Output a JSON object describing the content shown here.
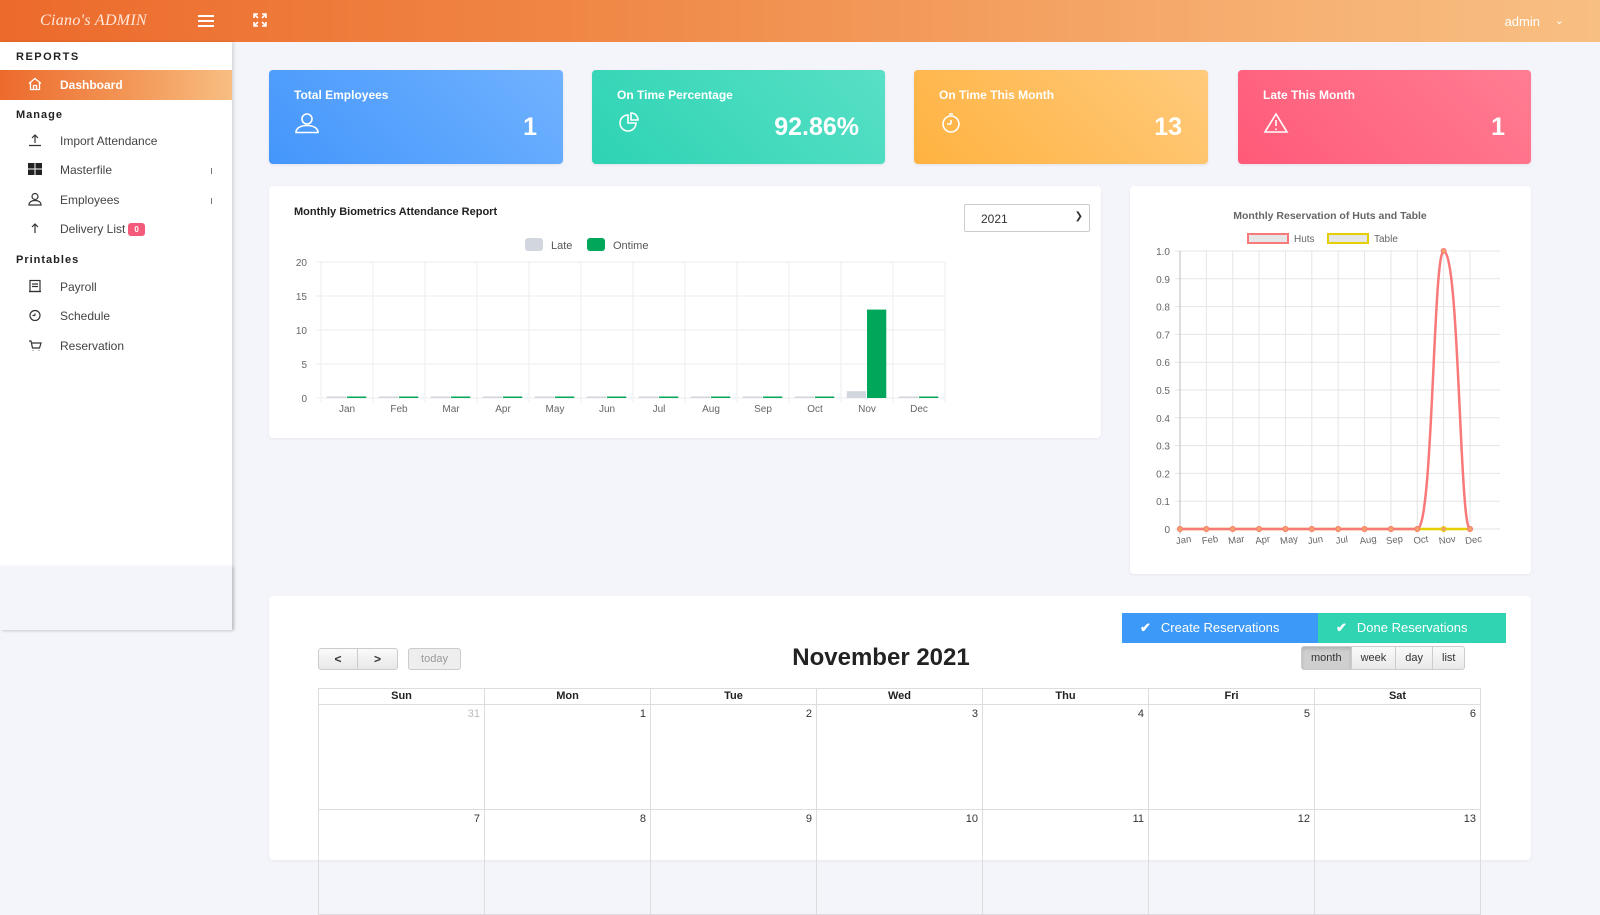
{
  "header": {
    "brand": "Ciano's ADMIN",
    "user": "admin"
  },
  "sidebar": {
    "sections": [
      "REPORTS",
      "Manage",
      "Printables"
    ],
    "active": {
      "label": "Dashboard",
      "icon": "home-icon"
    },
    "manage_items": [
      {
        "label": "Import Attendance",
        "icon": "upload-icon"
      },
      {
        "label": "Masterfile",
        "icon": "grid-icon",
        "expandable": true
      },
      {
        "label": "Employees",
        "icon": "user-icon",
        "expandable": true
      },
      {
        "label": "Delivery List",
        "icon": "arrow-up-icon",
        "badge": "0"
      }
    ],
    "printable_items": [
      {
        "label": "Payroll",
        "icon": "receipt-icon"
      },
      {
        "label": "Schedule",
        "icon": "clock-icon"
      },
      {
        "label": "Reservation",
        "icon": "cart-icon"
      }
    ]
  },
  "stats": [
    {
      "title": "Total Employees",
      "value": "1",
      "icon": "user-icon",
      "color": "#4c9bfb"
    },
    {
      "title": "On Time Percentage",
      "value": "92.86%",
      "icon": "pie-chart-icon",
      "color": "#3dd8bb"
    },
    {
      "title": "On Time This Month",
      "value": "13",
      "icon": "stopwatch-icon",
      "color": "#ffb84c"
    },
    {
      "title": "Late This Month",
      "value": "1",
      "icon": "warning-icon",
      "color": "#ff627e"
    }
  ],
  "attendance": {
    "year_select": "2021"
  },
  "chart_data": [
    {
      "type": "bar",
      "title": "Monthly Biometrics Attendance Report",
      "categories": [
        "Jan",
        "Feb",
        "Mar",
        "Apr",
        "May",
        "Jun",
        "Jul",
        "Aug",
        "Sep",
        "Oct",
        "Nov",
        "Dec"
      ],
      "series": [
        {
          "name": "Late",
          "color": "#d2d6de",
          "values": [
            0,
            0,
            0,
            0,
            0,
            0,
            0,
            0,
            0,
            0,
            1,
            0
          ]
        },
        {
          "name": "Ontime",
          "color": "#00a65a",
          "values": [
            0,
            0,
            0,
            0,
            0,
            0,
            0,
            0,
            0,
            0,
            13,
            0
          ]
        }
      ],
      "yticks": [
        "0",
        "5",
        "10",
        "15",
        "20"
      ],
      "ylim": [
        0,
        20
      ],
      "legend": "top-center",
      "grid": true
    },
    {
      "type": "line",
      "title": "Monthly Reservation of Huts and Table",
      "categories": [
        "Jan",
        "Feb",
        "Mar",
        "Apr",
        "May",
        "Jun",
        "Jul",
        "Aug",
        "Sep",
        "Oct",
        "Nov",
        "Dec"
      ],
      "series": [
        {
          "name": "Huts",
          "color": "#f87979",
          "values": [
            0,
            0,
            0,
            0,
            0,
            0,
            0,
            0,
            0,
            0,
            1,
            0
          ]
        },
        {
          "name": "Table",
          "color": "#e6cf00",
          "values": [
            0,
            0,
            0,
            0,
            0,
            0,
            0,
            0,
            0,
            0,
            0,
            0
          ]
        }
      ],
      "yticks": [
        "0",
        "0.1",
        "0.2",
        "0.3",
        "0.4",
        "0.5",
        "0.6",
        "0.7",
        "0.8",
        "0.9",
        "1.0"
      ],
      "ylim": [
        0,
        1
      ],
      "legend": "top-center",
      "grid": true
    }
  ],
  "calendar": {
    "title": "November 2021",
    "prev": "<",
    "next": ">",
    "today": "today",
    "create_btn": "Create Reservations",
    "done_btn": "Done Reservations",
    "views": [
      "month",
      "week",
      "day",
      "list"
    ],
    "active_view": "month",
    "weekdays": [
      "Sun",
      "Mon",
      "Tue",
      "Wed",
      "Thu",
      "Fri",
      "Sat"
    ],
    "weeks": [
      [
        {
          "d": "31",
          "other": true
        },
        {
          "d": "1"
        },
        {
          "d": "2"
        },
        {
          "d": "3"
        },
        {
          "d": "4"
        },
        {
          "d": "5"
        },
        {
          "d": "6"
        }
      ],
      [
        {
          "d": "7"
        },
        {
          "d": "8"
        },
        {
          "d": "9"
        },
        {
          "d": "10"
        },
        {
          "d": "11"
        },
        {
          "d": "12"
        },
        {
          "d": "13"
        }
      ]
    ]
  }
}
